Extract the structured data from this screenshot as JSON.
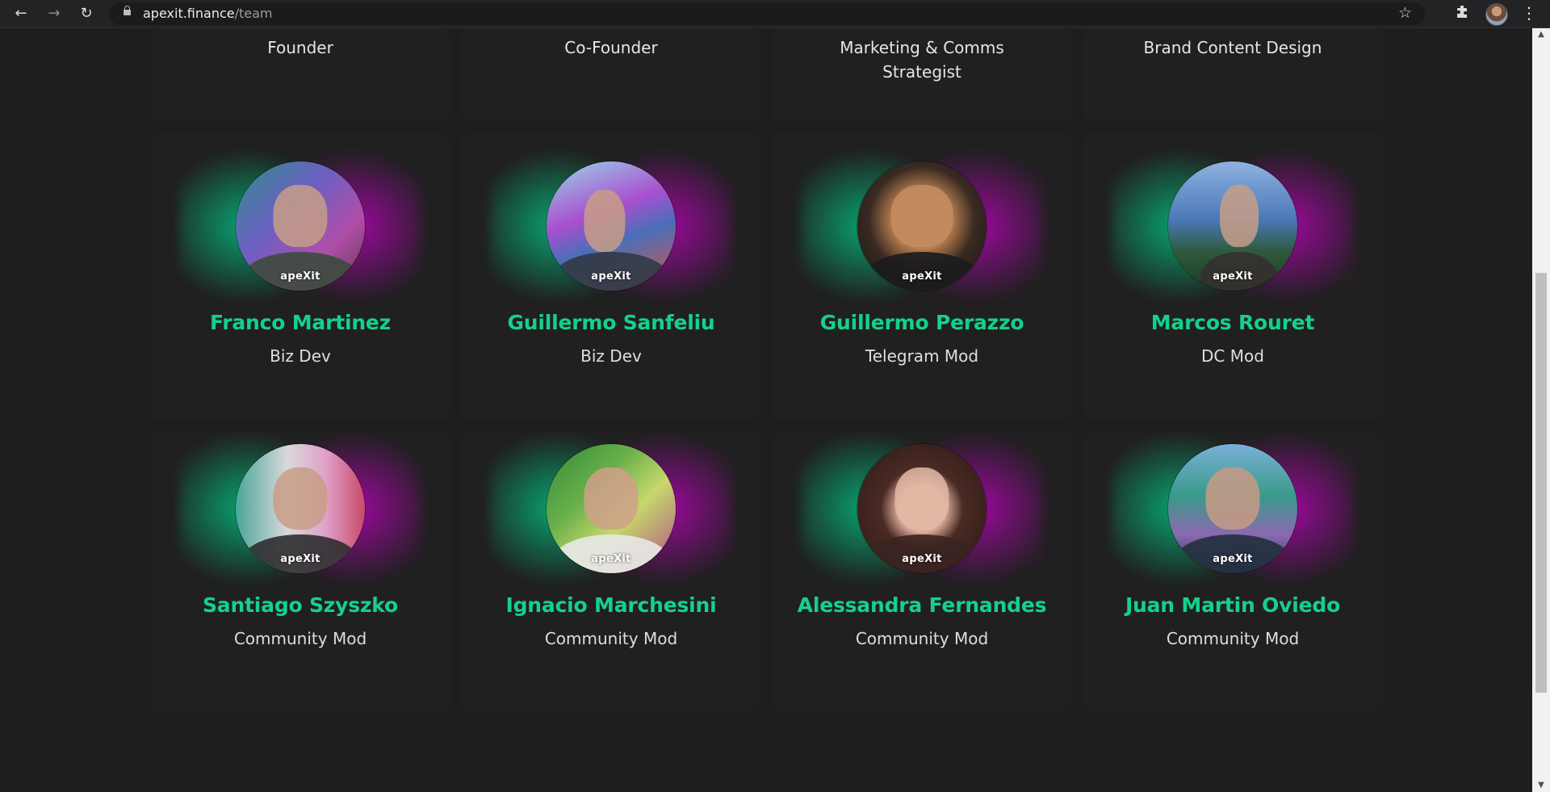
{
  "browser": {
    "url_host": "apexit.finance",
    "url_path": "/team",
    "back_icon": "←",
    "forward_icon": "→",
    "reload_icon": "↻",
    "bookmark_icon": "☆",
    "extensions_icon": "puzzle-icon",
    "menu_icon": "⋮"
  },
  "top_roles": [
    "Founder",
    "Co-Founder",
    "Marketing & Comms Strategist",
    "Brand Content Design"
  ],
  "members": [
    {
      "name": "Franco Martinez",
      "role": "Biz Dev",
      "watermark": "apeXit"
    },
    {
      "name": "Guillermo Sanfeliu",
      "role": "Biz Dev",
      "watermark": "apeXit"
    },
    {
      "name": "Guillermo Perazzo",
      "role": "Telegram Mod",
      "watermark": "apeXit"
    },
    {
      "name": "Marcos Rouret",
      "role": "DC Mod",
      "watermark": "apeXit"
    },
    {
      "name": "Santiago Szyszko",
      "role": "Community Mod",
      "watermark": "apeXit"
    },
    {
      "name": "Ignacio Marchesini",
      "role": "Community Mod",
      "watermark": "apeXit"
    },
    {
      "name": "Alessandra Fernandes",
      "role": "Community Mod",
      "watermark": "apeXit"
    },
    {
      "name": "Juan Martin Oviedo",
      "role": "Community Mod",
      "watermark": "apeXit"
    }
  ],
  "colors": {
    "accent": "#14d18b",
    "glow_green": "#00d28c",
    "glow_magenta": "#c800c8",
    "background": "#1e1e1e"
  }
}
